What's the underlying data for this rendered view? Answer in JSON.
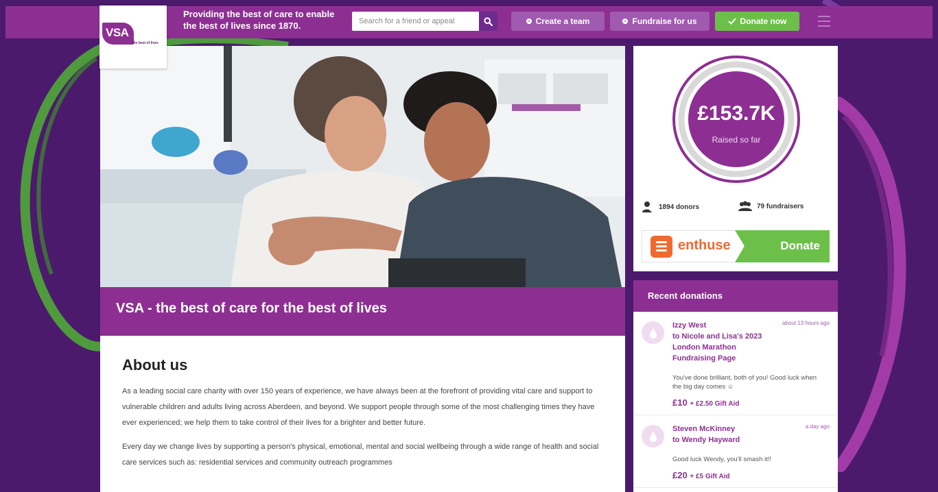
{
  "header": {
    "logo_text": "VSA",
    "logo_tagline": "the best of lives",
    "tagline": "Providing the best of care to enable the best of lives since 1870.",
    "search_placeholder": "Search for a friend or appeal",
    "create_team_label": "Create a team",
    "fundraise_label": "Fundraise for us",
    "donate_now_label": "Donate now"
  },
  "hero": {
    "title": "VSA - the best of care for the best of lives"
  },
  "about": {
    "heading": "About us",
    "paragraphs": [
      "As a leading social care charity with over 150 years of experience, we have always been at the forefront of providing vital care and support to vulnerable children and adults living across Aberdeen, and beyond. We support people through some of the most challenging times they have ever experienced; we help them to take control of their lives for a brighter and better future.",
      "Every day we change lives by supporting a person's physical, emotional, mental and social wellbeing through a wide range of health and social care services such as: residential services and community outreach programmes"
    ]
  },
  "fundraising": {
    "amount_raised": "£153.7K",
    "raised_label": "Raised so far",
    "donors": "1894 donors",
    "fundraisers": "79 fundraisers",
    "enthuse_label": "enthuse",
    "donate_label": "Donate"
  },
  "recent_donations": {
    "heading": "Recent donations",
    "items": [
      {
        "name": "Izzy West",
        "target": "to Nicole and Lisa's 2023 London Marathon Fundraising Page",
        "time": "about 13 hours ago",
        "message": "You've done brilliant, both of you! Good luck when the big day comes ☺",
        "amount": "£10",
        "gift_aid": "+ £2.50 Gift Aid"
      },
      {
        "name": "Steven McKinney",
        "target": "to Wendy Hayward",
        "time": "a day ago",
        "message": "Good luck Wendy, you'll smash it!!",
        "amount": "£20",
        "gift_aid": "+ £5 Gift Aid"
      }
    ]
  },
  "colors": {
    "brand_purple": "#8d2f92",
    "background_purple": "#4b1a6d",
    "accent_green": "#6cc04a",
    "enthuse_orange": "#ef6a2e"
  }
}
